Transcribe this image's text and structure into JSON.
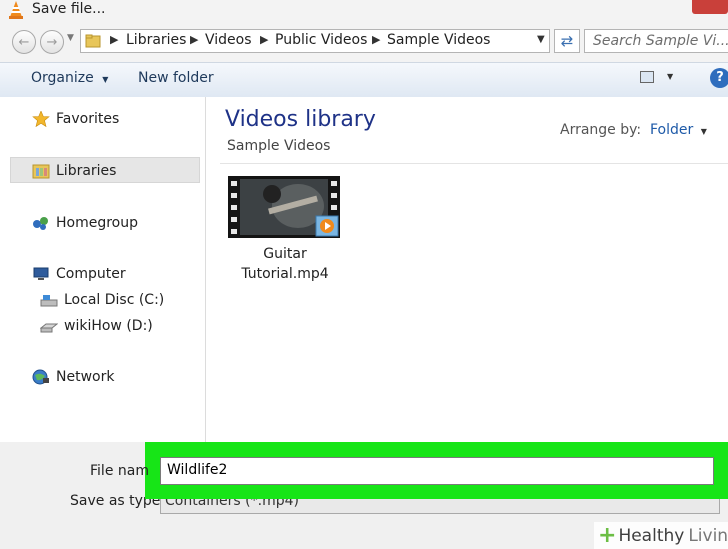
{
  "window": {
    "title": "Save file..."
  },
  "address": {
    "breadcrumbs": [
      "Libraries",
      "Videos",
      "Public Videos",
      "Sample Videos"
    ],
    "search_placeholder": "Search Sample Vi..."
  },
  "toolbar": {
    "organize": "Organize",
    "new_folder": "New folder",
    "help": "?"
  },
  "nav": {
    "favorites": "Favorites",
    "libraries": "Libraries",
    "homegroup": "Homegroup",
    "computer": "Computer",
    "local_disc": "Local Disc (C:)",
    "wikihow": "wikiHow (D:)",
    "network": "Network"
  },
  "content": {
    "title": "Videos library",
    "subtitle": "Sample Videos",
    "arrange_label": "Arrange by:",
    "arrange_value": "Folder",
    "files": [
      {
        "name_line1": "Guitar",
        "name_line2": "Tutorial.mp4"
      }
    ]
  },
  "form": {
    "file_name_label": "File nam",
    "file_name_value": "Wildlife2",
    "save_as_label": "Save as type:",
    "save_as_value": "Containers (*.mp4)"
  },
  "watermark": {
    "brand": "Healthy",
    "brand2": "Living"
  },
  "colors": {
    "highlight": "#17e517",
    "library_title": "#1e3287",
    "close": "#c9403a"
  }
}
